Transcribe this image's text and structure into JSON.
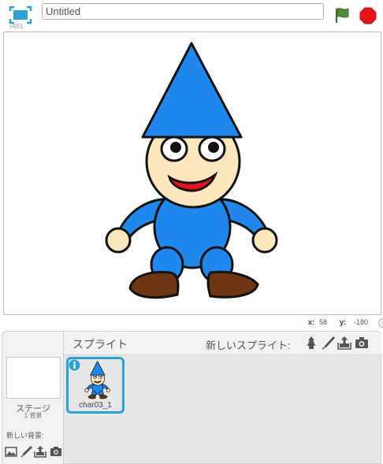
{
  "app": {
    "version": "v461",
    "project_title_value": "Untitled",
    "project_title_placeholder": ""
  },
  "icons": {
    "fullscreen": "fullscreen-icon",
    "green_flag": "green-flag-icon",
    "stop": "stop-sign-icon",
    "info": "info-icon",
    "choose_from_library": "sprite-library-icon",
    "paint": "paintbrush-icon",
    "upload": "upload-icon",
    "camera": "camera-icon",
    "backdrop_library": "landscape-icon"
  },
  "colors": {
    "accent": "#29a2d9",
    "flag_green": "#4d8c3a",
    "stop_red": "#e8121a",
    "character_blue": "#1e88ee",
    "skin": "#fde8bd",
    "shoe_brown": "#6e3511",
    "mouth_red": "#e8121a"
  },
  "stage": {
    "mouse_x_label": "x:",
    "mouse_x": "58",
    "mouse_y_label": "y:",
    "mouse_y": "-180"
  },
  "stage_panel": {
    "label": "ステージ",
    "backdrop_count": "1 背景",
    "new_backdrop_label": "新しい背景:"
  },
  "sprites_panel": {
    "title": "スプライト",
    "new_sprite_label": "新しいスプライト:",
    "sprites": [
      {
        "name": "char03_1",
        "selected": true
      }
    ]
  }
}
